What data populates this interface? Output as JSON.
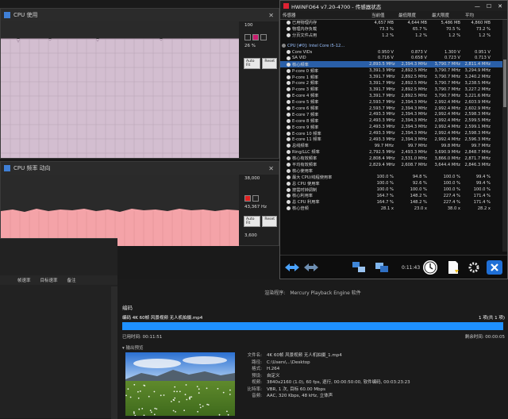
{
  "cpu_usage_window": {
    "title": "CPU 使用",
    "value_top": "100",
    "value_mid": "26 %",
    "buttons": [
      "Auto Fit",
      "Reset"
    ]
  },
  "cpu_clock_window": {
    "title": "CPU 频率 动向",
    "value_top": "38,000",
    "value_mid": "43,367 Hz",
    "value_bottom": "3,600",
    "buttons": [
      "Auto Fit",
      "Reset"
    ]
  },
  "colors": {
    "cpu_usage_fill": "#d3bed0",
    "cpu_clock_fill": "#f4a3a8",
    "selection": "#2a5fa8",
    "progress": "#1e90ff"
  },
  "hwinfo": {
    "title": "HWiNFO64 v7.20-4700 - 传感器状态",
    "headers": [
      "传感器",
      "当前值",
      "最低限度",
      "最大限度",
      "平均"
    ],
    "rows": [
      {
        "name": "已用物理内存",
        "cur": "4,657 MB",
        "min": "4,644 MB",
        "max": "5,486 MB",
        "avg": "4,860 MB"
      },
      {
        "name": "物理内存负载",
        "cur": "73.3 %",
        "min": "65.7 %",
        "max": "70.5 %",
        "avg": "73.2 %"
      },
      {
        "name": "分页文件占用",
        "cur": "1.2 %",
        "min": "1.2 %",
        "max": "1.2 %",
        "avg": "1.2 %"
      },
      {
        "name": "",
        "cur": "",
        "min": "",
        "max": "",
        "avg": "",
        "sep": true
      },
      {
        "name": "CPU [#0]: Intel Core i5-12...",
        "cur": "",
        "min": "",
        "max": "",
        "avg": "",
        "group": true
      },
      {
        "name": "Core VIDs",
        "cur": "0.950 V",
        "min": "0.873 V",
        "max": "1.300 V",
        "avg": "0.951 V"
      },
      {
        "name": "SA VID",
        "cur": "0.716 V",
        "min": "0.658 V",
        "max": "0.723 V",
        "avg": "0.713 V"
      },
      {
        "name": "核心频率",
        "cur": "2,893.5 MHz",
        "min": "2,394.3 MHz",
        "max": "3,790.7 MHz",
        "avg": "2,811.4 MHz",
        "selected": true
      },
      {
        "name": "P-core 0 频率",
        "cur": "3,391.3 MHz",
        "min": "2,892.5 MHz",
        "max": "3,790.7 MHz",
        "avg": "3,294.9 MHz"
      },
      {
        "name": "P-core 1 频率",
        "cur": "3,391.7 MHz",
        "min": "2,892.5 MHz",
        "max": "3,790.7 MHz",
        "avg": "3,240.2 MHz"
      },
      {
        "name": "P-core 2 频率",
        "cur": "3,391.7 MHz",
        "min": "2,892.5 MHz",
        "max": "3,790.7 MHz",
        "avg": "3,238.5 MHz"
      },
      {
        "name": "P-core 3 频率",
        "cur": "3,391.7 MHz",
        "min": "2,892.5 MHz",
        "max": "3,790.7 MHz",
        "avg": "3,227.2 MHz"
      },
      {
        "name": "E-core 4 频率",
        "cur": "3,391.7 MHz",
        "min": "2,892.5 MHz",
        "max": "3,790.7 MHz",
        "avg": "3,221.6 MHz"
      },
      {
        "name": "E-core 5 频率",
        "cur": "2,593.7 MHz",
        "min": "2,394.3 MHz",
        "max": "2,992.4 MHz",
        "avg": "2,603.9 MHz"
      },
      {
        "name": "E-core 6 频率",
        "cur": "2,593.7 MHz",
        "min": "2,394.3 MHz",
        "max": "2,992.4 MHz",
        "avg": "2,602.9 MHz"
      },
      {
        "name": "E-core 7 频率",
        "cur": "2,493.3 MHz",
        "min": "2,394.3 MHz",
        "max": "2,992.4 MHz",
        "avg": "2,598.3 MHz"
      },
      {
        "name": "E-core 8 频率",
        "cur": "2,493.3 MHz",
        "min": "2,394.3 MHz",
        "max": "2,992.4 MHz",
        "avg": "2,599.5 MHz"
      },
      {
        "name": "E-core 9 频率",
        "cur": "2,493.3 MHz",
        "min": "2,394.3 MHz",
        "max": "2,992.4 MHz",
        "avg": "2,599.1 MHz"
      },
      {
        "name": "E-core 10 频率",
        "cur": "2,493.3 MHz",
        "min": "2,394.3 MHz",
        "max": "2,992.4 MHz",
        "avg": "2,598.3 MHz"
      },
      {
        "name": "E-core 11 频率",
        "cur": "2,493.3 MHz",
        "min": "2,394.3 MHz",
        "max": "2,992.4 MHz",
        "avg": "2,596.3 MHz"
      },
      {
        "name": "总线频率",
        "cur": "99.7 MHz",
        "min": "99.7 MHz",
        "max": "99.8 MHz",
        "avg": "99.7 MHz"
      },
      {
        "name": "Ring/LLC 频率",
        "cur": "2,792.5 MHz",
        "min": "2,493.3 MHz",
        "max": "3,690.9 MHz",
        "avg": "2,848.7 MHz"
      },
      {
        "name": "核心有效频率",
        "cur": "2,808.4 MHz",
        "min": "2,531.0 MHz",
        "max": "3,866.0 MHz",
        "avg": "2,871.7 MHz"
      },
      {
        "name": "平均有效频率",
        "cur": "2,829.4 MHz",
        "min": "2,608.7 MHz",
        "max": "3,644.4 MHz",
        "avg": "2,846.3 MHz"
      },
      {
        "name": "核心使用率",
        "cur": "",
        "min": "",
        "max": "",
        "avg": ""
      },
      {
        "name": "最大 CPU/线程使用率",
        "cur": "100.0 %",
        "min": "94.8 %",
        "max": "100.0 %",
        "avg": "99.4 %"
      },
      {
        "name": "总 CPU 使用率",
        "cur": "100.0 %",
        "min": "92.6 %",
        "max": "100.0 %",
        "avg": "99.4 %"
      },
      {
        "name": "按需时钟调制",
        "cur": "100.0 %",
        "min": "100.0 %",
        "max": "100.0 %",
        "avg": "100.0 %"
      },
      {
        "name": "核心利用率",
        "cur": "164.7 %",
        "min": "148.2 %",
        "max": "227.4 %",
        "avg": "171.4 %"
      },
      {
        "name": "总 CPU 利用率",
        "cur": "164.7 %",
        "min": "148.2 %",
        "max": "227.4 %",
        "avg": "171.4 %"
      },
      {
        "name": "核心倍频",
        "cur": "28.1 x",
        "min": "23.0 x",
        "max": "38.0 x",
        "avg": "28.2 x"
      }
    ],
    "clock": "0:11:43"
  },
  "leftpanel": {
    "columns": [
      "帧速率",
      "目标速率",
      "备注"
    ]
  },
  "encoder": {
    "engine_label": "渲染程序:",
    "engine_value": "Mercury Playback Engine 软件",
    "section": "编码",
    "file": "编码 4K 60帧 风景视频 无人机拍摄.mp4",
    "ratio": "1 项(共 1 项)",
    "progress": 1.0,
    "elapsed": "已用时间: 00:11:51",
    "remaining": "剩余时间: 00:00:05",
    "preview_label": "▾ 输出预览",
    "info": [
      {
        "k": "文件名:",
        "v": "4K 60帧 风景视频 无人机拍摄_1.mp4"
      },
      {
        "k": "路径:",
        "v": "C:\\Users\\...\\Desktop"
      },
      {
        "k": "格式:",
        "v": "H.264"
      },
      {
        "k": "预设:",
        "v": "自定义"
      },
      {
        "k": "",
        "v": ""
      },
      {
        "k": "视频:",
        "v": "3840x2160 (1.0), 60 fps, 逐行, 00:00:50:00, 软件编码, 00:03:23:23"
      },
      {
        "k": "比特率:",
        "v": "VBR, 1 次, 目标 60.00 Mbps"
      },
      {
        "k": "音频:",
        "v": "AAC, 320 Kbps, 48 kHz, 立体声"
      }
    ]
  }
}
